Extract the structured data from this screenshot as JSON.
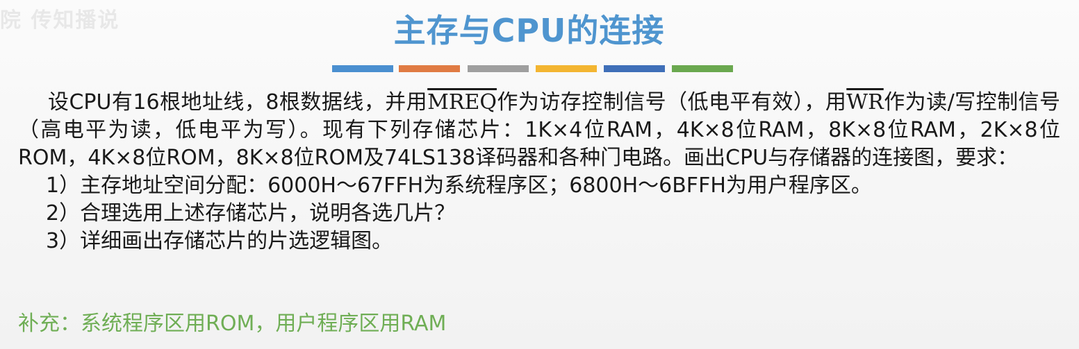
{
  "watermark_text": "院 传知播说",
  "title": "主存与CPU的连接",
  "color_bars": {
    "blue": "#4a8fd0",
    "orange": "#e07b43",
    "gray": "#9f9f9f",
    "yellow": "#f3b531",
    "darkblue": "#3f6fb8",
    "green": "#6aa84f"
  },
  "problem": {
    "text1": "设CPU有16根地址线，8根数据线，并用",
    "signal1": "MREQ",
    "text2": "作为访存控制信号（低电平有效），用",
    "signal2": "WR",
    "text3": "作为读/写控制信号（高电平为读，低电平为写）。现有下列存储芯片：1K×4位RAM，4K×8位RAM，8K×8位RAM，2K×8位ROM，4K×8位ROM，8K×8位ROM及74LS138译码器和各种门电路。画出CPU与存储器的连接图，要求："
  },
  "requirements": [
    "1）主存地址空间分配：6000H～67FFH为系统程序区；6800H～6BFFH为用户程序区。",
    "2）合理选用上述存储芯片，说明各选几片？",
    "3）详细画出存储芯片的片选逻辑图。"
  ],
  "supplement": "补充：系统程序区用ROM，用户程序区用RAM",
  "colors": {
    "title": "#4f95cf",
    "body_text": "#1a1a1a",
    "supplement": "#6fae55"
  }
}
